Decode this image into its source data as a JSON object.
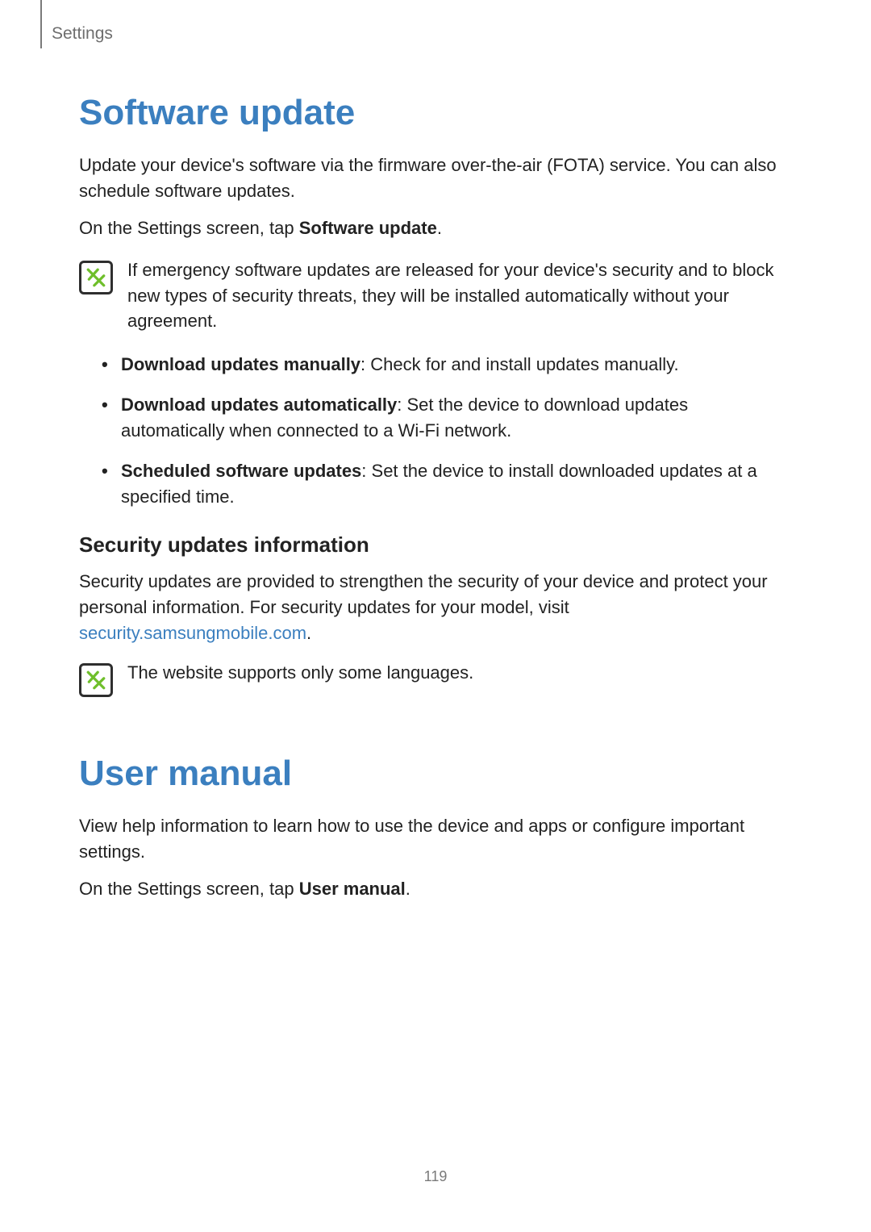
{
  "header": {
    "section": "Settings"
  },
  "section1": {
    "title": "Software update",
    "intro": "Update your device's software via the firmware over-the-air (FOTA) service. You can also schedule software updates.",
    "instruction_prefix": "On the Settings screen, tap ",
    "instruction_bold": "Software update",
    "instruction_suffix": ".",
    "note": "If emergency software updates are released for your device's security and to block new types of security threats, they will be installed automatically without your agreement.",
    "bullets": [
      {
        "bold": "Download updates manually",
        "text": ": Check for and install updates manually."
      },
      {
        "bold": "Download updates automatically",
        "text": ": Set the device to download updates automatically when connected to a Wi-Fi network."
      },
      {
        "bold": "Scheduled software updates",
        "text": ": Set the device to install downloaded updates at a specified time."
      }
    ],
    "subheading": "Security updates information",
    "security_prefix": "Security updates are provided to strengthen the security of your device and protect your personal information. For security updates for your model, visit ",
    "security_link": "security.samsungmobile.com",
    "security_suffix": ".",
    "note2": "The website supports only some languages."
  },
  "section2": {
    "title": "User manual",
    "intro": "View help information to learn how to use the device and apps or configure important settings.",
    "instruction_prefix": "On the Settings screen, tap ",
    "instruction_bold": "User manual",
    "instruction_suffix": "."
  },
  "page_number": "119"
}
